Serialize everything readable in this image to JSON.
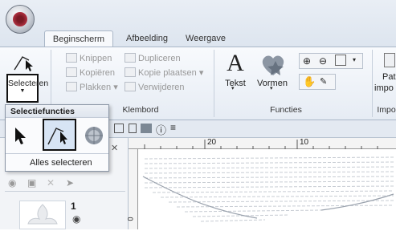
{
  "app": {
    "button_icon": "app-menu-icon"
  },
  "tabs": [
    "Beginscherm",
    "Afbeelding",
    "Weergave"
  ],
  "ribbon": {
    "select": {
      "label": "Selecteren",
      "icon": "select-tool-icon"
    },
    "clipboard": {
      "items": [
        "Knippen",
        "Kopiëren",
        "Plakken",
        "Dupliceren",
        "Kopie plaatsen",
        "Verwijderen"
      ],
      "group_label": "Klembord"
    },
    "functions": {
      "text_label": "Tekst",
      "shapes_label": "Vormen",
      "group_label": "Functies"
    },
    "import": {
      "label_line1": "Pat",
      "label_line2": "impo",
      "group_label": "Impo"
    }
  },
  "popup": {
    "title": "Selectiefuncties",
    "select_all_label": "Alles selecteren"
  },
  "object": {
    "number": "1"
  },
  "rulers": {
    "h_marks": [
      "20",
      "10"
    ],
    "v_mark": "0"
  },
  "colors": {
    "highlight": "#111111",
    "accent": "#1f5fa8"
  }
}
